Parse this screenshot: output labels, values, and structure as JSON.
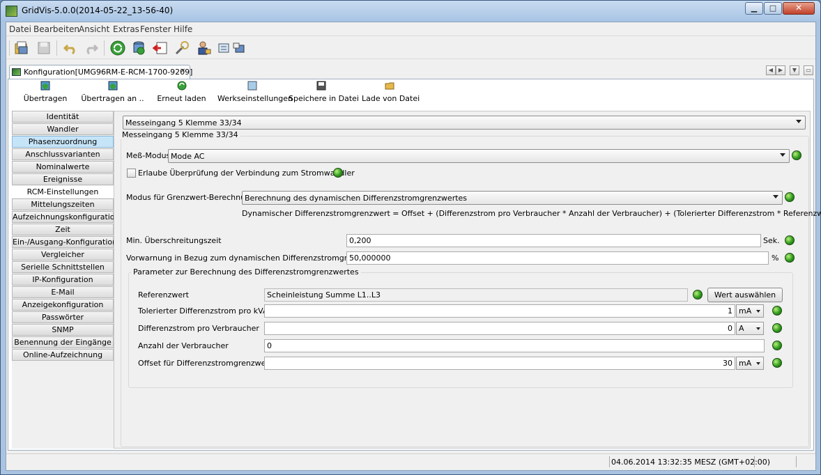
{
  "window": {
    "title": "GridVis-5.0.0(2014-05-22_13-56-40)",
    "minimize": "▁",
    "maximize": "□",
    "close": "✕"
  },
  "menu": [
    "Datei",
    "Bearbeiten",
    "Ansicht",
    "Extras",
    "Fenster",
    "Hilfe"
  ],
  "tab": {
    "label": "Konfiguration[UMG96RM-E-RCM-1700-9209]",
    "close": "✕"
  },
  "actions": [
    "Übertragen",
    "Übertragen an ..",
    "Erneut laden",
    "Werkseinstellungen",
    "Speichere in Datei",
    "Lade von Datei"
  ],
  "nav": [
    "Identität",
    "Wandler",
    "Phasenzuordnung",
    "Anschlussvarianten",
    "Nominalwerte",
    "Ereignisse",
    "RCM-Einstellungen",
    "Mittelungszeiten",
    "Aufzeichnungskonfiguration",
    "Zeit",
    "Ein-/Ausgang-Konfiguration",
    "Vergleicher",
    "Serielle Schnittstellen",
    "IP-Konfiguration",
    "E-Mail",
    "Anzeigekonfiguration",
    "Passwörter",
    "SNMP",
    "Benennung der Eingänge",
    "Online-Aufzeichnung"
  ],
  "content": {
    "input_select": "Messeingang 5 Klemme 33/34",
    "group_title": "Messeingang 5 Klemme 33/34",
    "mode_label": "Meß-Modus",
    "mode_value": "Mode AC",
    "check_label": "Erlaube Überprüfung der Verbindung zum Stromwandler",
    "limit_mode_label": "Modus für Grenzwert-Berechnung",
    "limit_mode_value": "Berechnung des dynamischen Differenzstromgrenzwertes",
    "formula": "Dynamischer Differenzstromgrenzwert = Offset + (Differenzstrom pro Verbraucher * Anzahl der Verbraucher) + (Tolerierter Differenzstrom * Referenzwert)",
    "min_time_label": "Min. Überschreitungszeit",
    "min_time_value": "0,200",
    "min_time_unit": "Sek.",
    "prewarn_label": "Vorwarnung in Bezug zum dynamischen Differenzstromgrenzwert",
    "prewarn_value": "50,000000",
    "prewarn_unit": "%",
    "param_group_title": "Parameter zur Berechnung des Differenzstromgrenzwertes",
    "ref_label": "Referenzwert",
    "ref_value": "Scheinleistung Summe L1..L3",
    "ref_button": "Wert auswählen",
    "tol_label": "Tolerierter Differenzstrom pro kVA",
    "tol_value": "1",
    "tol_unit": "mA",
    "diff_label": "Differenzstrom pro Verbraucher",
    "diff_value": "0",
    "diff_unit": "A",
    "count_label": "Anzahl der Verbraucher",
    "count_value": "0",
    "offset_label": "Offset für Differenzstromgrenzwert",
    "offset_value": "30",
    "offset_unit": "mA"
  },
  "status": {
    "time": "04.06.2014 13:32:35 MESZ (GMT+02:00)"
  }
}
